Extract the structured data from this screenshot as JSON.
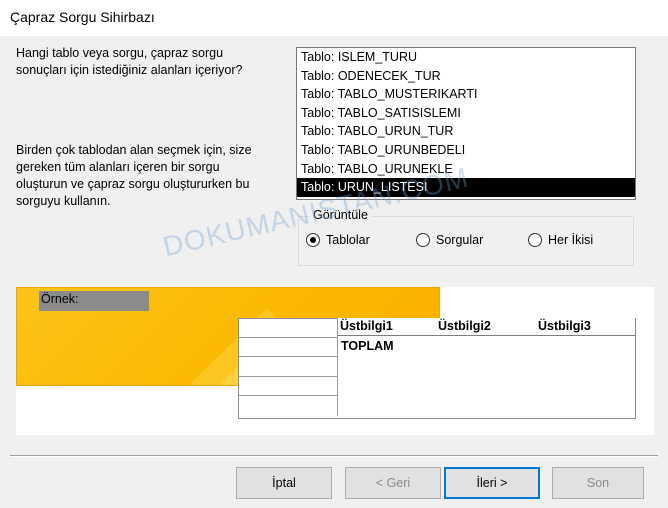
{
  "window": {
    "title": "Çapraz Sorgu Sihirbazı"
  },
  "instructions": {
    "question": "Hangi tablo veya sorgu, çapraz sorgu\nsonuçları için istediğiniz alanları içeriyor?",
    "hint": "Birden çok tablodan alan seçmek için, size\ngereken tüm alanları içeren bir sorgu\noluşturun ve çapraz sorgu oluştururken bu\nsorguyu kullanın."
  },
  "source_list": {
    "items": [
      "Tablo: ISLEM_TURU",
      "Tablo: ODENECEK_TUR",
      "Tablo: TABLO_MUSTERIKARTI",
      "Tablo: TABLO_SATISISLEMI",
      "Tablo: TABLO_URUN_TUR",
      "Tablo: TABLO_URUNBEDELI",
      "Tablo: TABLO_URUNEKLE",
      "Tablo: URUN_LISTESI"
    ],
    "selected_index": 7
  },
  "view_group": {
    "legend": "Görüntüle",
    "options": [
      "Tablolar",
      "Sorgular",
      "Her İkisi"
    ],
    "selected": "Tablolar"
  },
  "sample": {
    "label": "Örnek:",
    "headers": [
      "Üstbilgi1",
      "Üstbilgi2",
      "Üstbilgi3"
    ],
    "total_label": "TOPLAM"
  },
  "watermark": "DOKUMANISTAN.COM",
  "buttons": {
    "cancel": "İptal",
    "back": "< Geri",
    "next": "İleri >",
    "finish": "Son"
  },
  "colors": {
    "sample_accent": "#fbb800",
    "selection": "#000000",
    "default_button_border": "#0078d7"
  }
}
